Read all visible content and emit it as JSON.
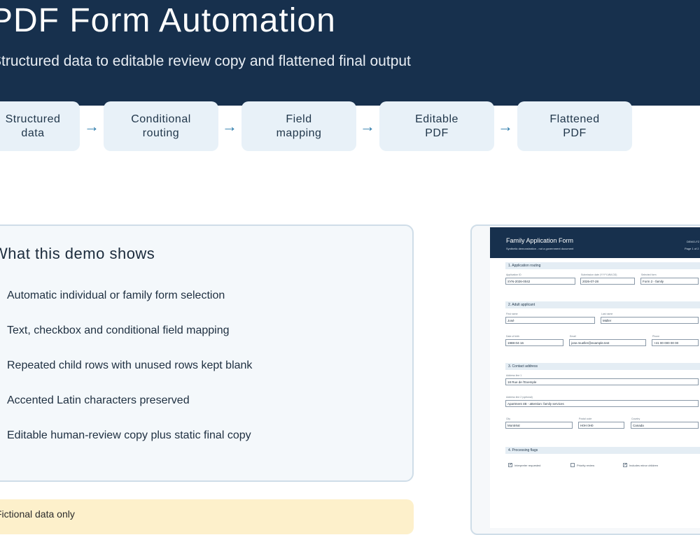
{
  "hero": {
    "title": "PDF Form Automation",
    "subtitle": "Structured data to editable review copy and flattened final output"
  },
  "pipeline": {
    "steps": [
      "Structured\ndata",
      "Conditional\nrouting",
      "Field\nmapping",
      "Editable\nPDF",
      "Flattened\nPDF"
    ],
    "arrow": "→"
  },
  "demo": {
    "title": "What this demo shows",
    "features": [
      "Automatic individual or family form selection",
      "Text, checkbox and conditional field mapping",
      "Repeated child rows with unused rows kept blank",
      "Accented Latin characters preserved",
      "Editable human-review copy plus static final copy"
    ]
  },
  "note": {
    "text": "Fictional data only"
  },
  "preview": {
    "title": "Family Application Form",
    "subtitle": "Synthetic demonstration - not a government document",
    "code": "DEMO-FZ",
    "page": "Page 1 of 2",
    "sections": [
      "1. Application routing",
      "2. Adult applicant",
      "3. Contact address",
      "4. Processing flags"
    ],
    "fields": {
      "app_id": {
        "label": "Application ID",
        "value": "SYN-2026-0042"
      },
      "sub_date": {
        "label": "Submission date (YYYY-MM-DD)",
        "value": "2026-07-28"
      },
      "form": {
        "label": "Selected form",
        "value": "Form 2 - family"
      },
      "first": {
        "label": "First name",
        "value": "José"
      },
      "last": {
        "label": "Last name",
        "value": "Müller"
      },
      "dob": {
        "label": "Date of birth",
        "value": "1988-04-16"
      },
      "email": {
        "label": "Email",
        "value": "jose.mueller@example.test"
      },
      "phone": {
        "label": "Phone",
        "value": "+41 00 000 00 00"
      },
      "addr1": {
        "label": "Address line 1",
        "value": "18 Rue de l'Exemple"
      },
      "addr2": {
        "label": "Address line 2 (optional)",
        "value": "Apartment 4B - attention: family services"
      },
      "city": {
        "label": "City",
        "value": "Montréal"
      },
      "postal": {
        "label": "Postal code",
        "value": "H0H 0H0"
      },
      "country": {
        "label": "Country",
        "value": "Canada"
      }
    },
    "flags": [
      {
        "label": "Interpreter requested",
        "checked": "✓"
      },
      {
        "label": "Priority review",
        "checked": ""
      },
      {
        "label": "Includes minor children",
        "checked": "✓"
      }
    ]
  }
}
